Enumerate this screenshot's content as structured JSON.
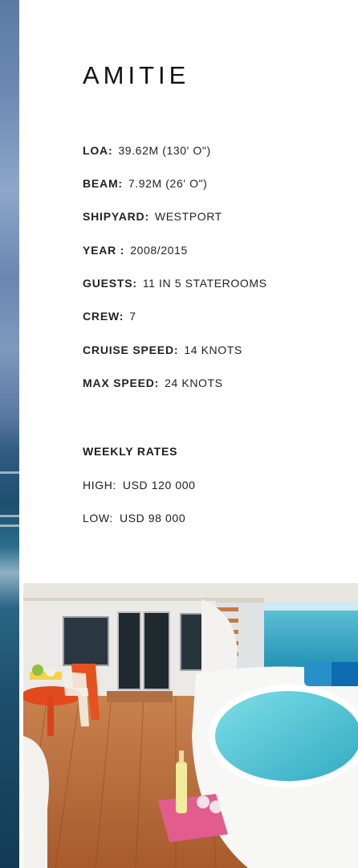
{
  "yacht_name": "AMITIE",
  "specs": [
    {
      "label": "LOA:",
      "value": "39.62M (130' O\")"
    },
    {
      "label": "BEAM:",
      "value": "7.92M (26' O\")"
    },
    {
      "label": "SHIPYARD:",
      "value": "WESTPORT"
    },
    {
      "label": "YEAR :",
      "value": "2008/2015"
    },
    {
      "label": "GUESTS:",
      "value": "11 IN 5 STATEROOMS"
    },
    {
      "label": "CREW:",
      "value": "7"
    },
    {
      "label": "CRUISE SPEED:",
      "value": "14 KNOTS"
    },
    {
      "label": "MAX SPEED:",
      "value": "24 KNOTS"
    }
  ],
  "weekly_rates": {
    "heading": "WEEKLY RATES",
    "items": [
      {
        "label": "HIGH:",
        "value": "USD 120 000"
      },
      {
        "label": "LOW:",
        "value": "USD 98 000"
      }
    ]
  },
  "colors": {
    "text": "#1c1c1c",
    "sea": "#2b6585",
    "deck": "#b5683a",
    "jacuzzi_water": "#4cc3d2"
  }
}
